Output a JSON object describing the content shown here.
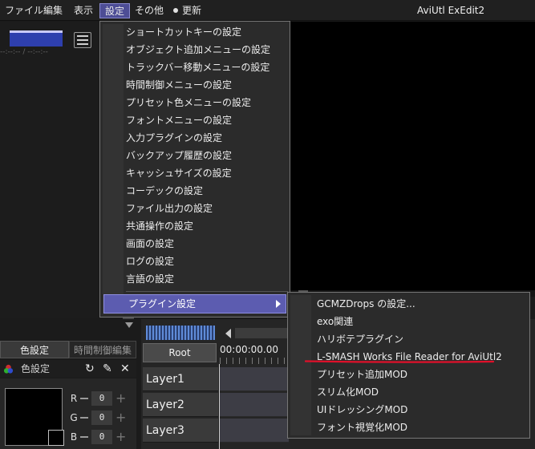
{
  "menubar": {
    "items": [
      "ファイル",
      "編集",
      "表示",
      "設定",
      "その他"
    ],
    "update_label": "更新",
    "app_title": "AviUtl ExEdit2"
  },
  "preview": {
    "time_placeholder": "--:--:-- / --:--:--"
  },
  "settings_menu": {
    "items": [
      "ショートカットキーの設定",
      "オブジェクト追加メニューの設定",
      "トラックバー移動メニューの設定",
      "時間制御メニューの設定",
      "プリセット色メニューの設定",
      "フォントメニューの設定",
      "入力プラグインの設定",
      "バックアップ履歴の設定",
      "キャッシュサイズの設定",
      "コーデックの設定",
      "ファイル出力の設定",
      "共通操作の設定",
      "画面の設定",
      "ログの設定",
      "言語の設定"
    ],
    "plugin_settings_label": "プラグイン設定"
  },
  "plugin_submenu": {
    "items": [
      "GCMZDrops の設定...",
      "exo関連",
      "ハリボテプラグイン",
      "L-SMASH Works File Reader for AviUtl2",
      "プリセット追加MOD",
      "スリム化MOD",
      "UIドレッシングMOD",
      "フォント視覚化MOD"
    ],
    "highlight_color": "#e0102a"
  },
  "timeline": {
    "root_label": "Root",
    "time": "00:00:00.00",
    "layers": [
      "Layer1",
      "Layer2",
      "Layer3"
    ]
  },
  "color_panel": {
    "tab_color": "色設定",
    "tab_time": "時間制御編集",
    "title": "色設定",
    "r_label": "R",
    "g_label": "G",
    "b_label": "B",
    "r_value": "0",
    "g_value": "0",
    "b_value": "0"
  },
  "colors": {
    "accent": "#5c5cb0",
    "background": "#1b1b1b"
  }
}
